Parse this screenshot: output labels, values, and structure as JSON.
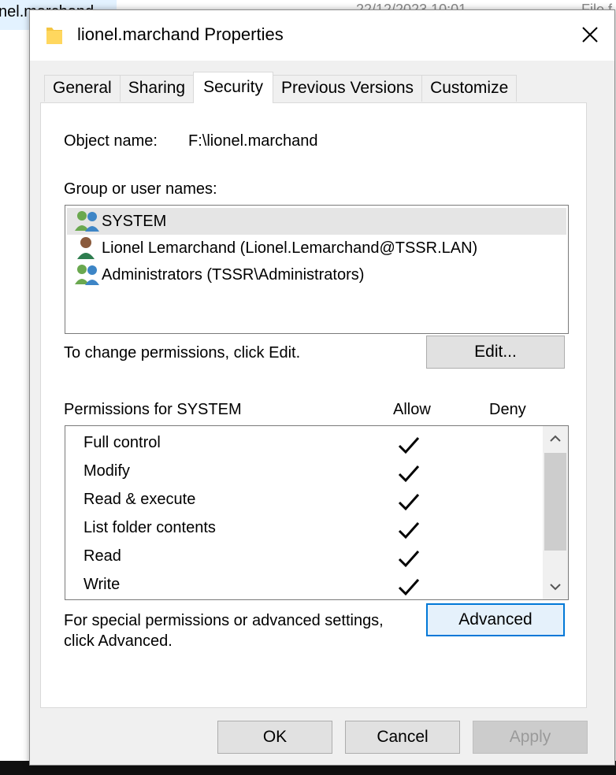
{
  "background": {
    "selected_item_text": "nel.marchand",
    "date_text": "22/12/2023 10:01",
    "type_text": "File f"
  },
  "dialog": {
    "title": "lionel.marchand Properties",
    "tabs": [
      {
        "label": "General",
        "active": false
      },
      {
        "label": "Sharing",
        "active": false
      },
      {
        "label": "Security",
        "active": true
      },
      {
        "label": "Previous Versions",
        "active": false
      },
      {
        "label": "Customize",
        "active": false
      }
    ],
    "security": {
      "object_name_label": "Object name:",
      "object_name_value": "F:\\lionel.marchand",
      "group_label": "Group or user names:",
      "users": [
        {
          "name": "SYSTEM",
          "icon": "group-icon",
          "selected": true
        },
        {
          "name": "Lionel Lemarchand (Lionel.Lemarchand@TSSR.LAN)",
          "icon": "user-icon",
          "selected": false
        },
        {
          "name": "Administrators (TSSR\\Administrators)",
          "icon": "group-icon",
          "selected": false
        }
      ],
      "change_text": "To change permissions, click Edit.",
      "edit_button": "Edit...",
      "permissions_label": "Permissions for SYSTEM",
      "allow_header": "Allow",
      "deny_header": "Deny",
      "permissions": [
        {
          "name": "Full control",
          "allow": true,
          "deny": false
        },
        {
          "name": "Modify",
          "allow": true,
          "deny": false
        },
        {
          "name": "Read & execute",
          "allow": true,
          "deny": false
        },
        {
          "name": "List folder contents",
          "allow": true,
          "deny": false
        },
        {
          "name": "Read",
          "allow": true,
          "deny": false
        },
        {
          "name": "Write",
          "allow": true,
          "deny": false
        }
      ],
      "advanced_text_line1": "For special permissions or advanced settings,",
      "advanced_text_line2": "click Advanced.",
      "advanced_button": "Advanced"
    },
    "buttons": {
      "ok": "OK",
      "cancel": "Cancel",
      "apply": "Apply"
    }
  },
  "colors": {
    "accent": "#0078d7",
    "dialog_bg": "#f0f0f0",
    "selection": "#e5e5e5"
  }
}
